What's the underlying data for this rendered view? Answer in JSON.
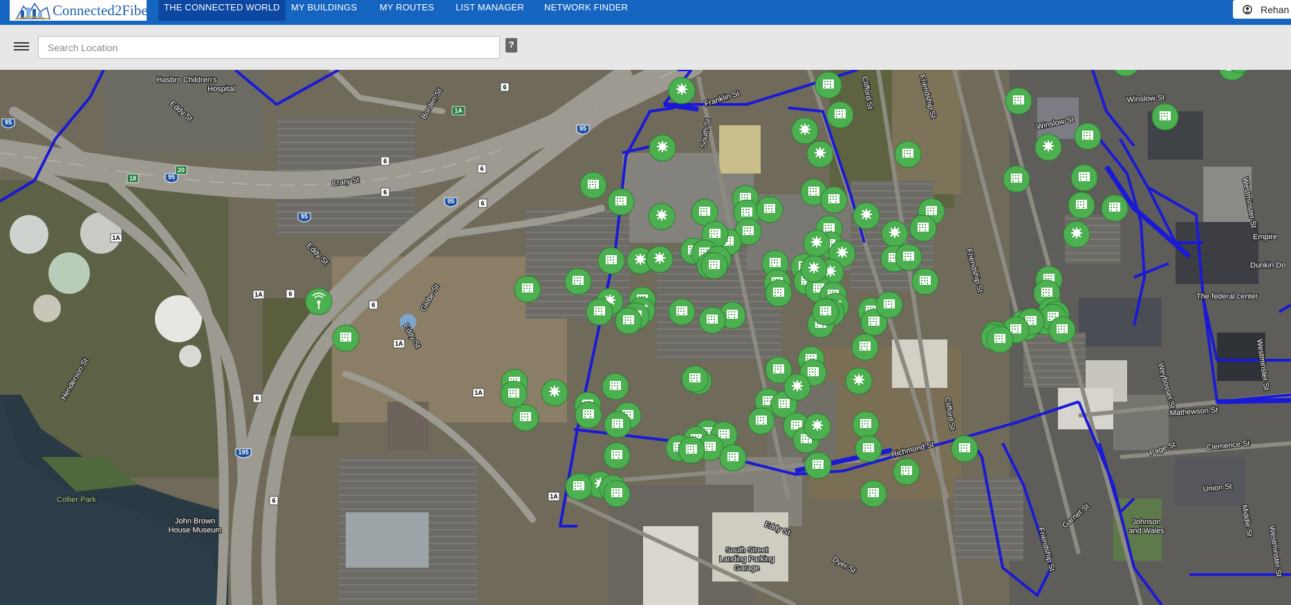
{
  "app": {
    "brand": "Connected2Fiber",
    "user_name": "Rehan",
    "user_icon": "user-circle-icon"
  },
  "nav": {
    "items": [
      {
        "label": "THE CONNECTED WORLD",
        "active": true
      },
      {
        "label": "MY BUILDINGS",
        "active": false
      },
      {
        "label": "MY ROUTES",
        "active": false
      },
      {
        "label": "LIST MANAGER",
        "active": false
      },
      {
        "label": "NETWORK FINDER",
        "active": false
      }
    ]
  },
  "toolbar": {
    "menu_icon": "hamburger-icon",
    "search_placeholder": "Search Location",
    "help_label": "?"
  },
  "colors": {
    "nav_bg": "#1565c0",
    "nav_active": "#0d47a1",
    "route_line": "#1a1ad6",
    "marker": "#4caf50"
  },
  "map": {
    "labels": {
      "hasbro": [
        "Hasbro Children's",
        "Hospital"
      ],
      "eddy_st": "Eddy St",
      "borden_st": "Borden St",
      "crary_st": "Crary St",
      "franklin_st": "Franklin St",
      "south_st": "South St",
      "clifford_st": "Clifford St",
      "friendship_st": "Friendship St",
      "winslow_st": "Winslow St",
      "westminster_st": "Westminster St",
      "empire": "Empire",
      "dunkin": "Dunkin Do",
      "federal_center": "The federal center",
      "globe_st": "Globe St",
      "henderson_st": "Henderson St",
      "collier_park": "Collier Park",
      "john_brown": [
        "John Brown",
        "House Museum"
      ],
      "richmond_st": "Richmond St",
      "garnet_st": "Garnet St",
      "page_st": "Page St",
      "clemence_st": "Clemence St",
      "union_st": "Union St",
      "middle_st": "Middle St",
      "mathewson_st": "Mathewson St",
      "weybosset_st": "Weybosset St",
      "johnson_wales": [
        "Johnson",
        "and Wales"
      ],
      "south_street_garage": [
        "South Street",
        "Landing Parking",
        "Garage"
      ],
      "dyer_st": "Dyer St"
    },
    "shields": {
      "i95": "95",
      "i195": "195",
      "route6": "6",
      "route1a": "1A",
      "exit20": "20",
      "exit18": "18"
    },
    "marker_types": {
      "building": "building-marker-icon",
      "hub": "hub-marker-icon",
      "tower": "tower-marker-icon"
    }
  }
}
